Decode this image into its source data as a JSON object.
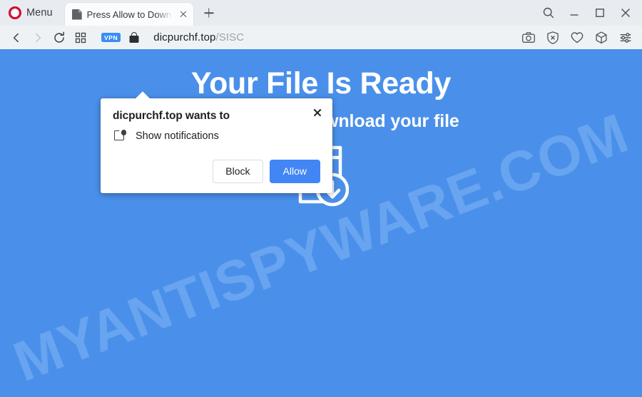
{
  "browser": {
    "name": "Opera",
    "menu_label": "Menu",
    "menu_icon": "opera-logo-icon",
    "tabs": [
      {
        "title": "Press Allow to Downl",
        "favicon": "page-document-icon",
        "close_icon": "close-icon",
        "active": true
      }
    ],
    "new_tab_icon": "plus-icon",
    "window_controls": [
      {
        "name": "search-window-button",
        "icon": "search-icon"
      },
      {
        "name": "minimize-button",
        "icon": "minimize-icon"
      },
      {
        "name": "maximize-button",
        "icon": "maximize-square-icon"
      },
      {
        "name": "close-window-button",
        "icon": "close-icon"
      }
    ],
    "nav": {
      "back_icon": "chevron-left-icon",
      "forward_icon": "chevron-right-icon",
      "reload_icon": "reload-icon",
      "tab_grid_icon": "grid-squares-icon"
    },
    "address_bar": {
      "vpn_badge": "VPN",
      "security_icon": "lock-icon",
      "url_host": "dicpurchf.top",
      "url_path": "/SISC"
    },
    "toolbar_right": [
      {
        "name": "snapshot-button",
        "icon": "camera-icon"
      },
      {
        "name": "ad-blocker-button",
        "icon": "shield-x-icon"
      },
      {
        "name": "favorites-button",
        "icon": "heart-icon"
      },
      {
        "name": "extensions-button",
        "icon": "cube-icon"
      },
      {
        "name": "easy-setup-button",
        "icon": "sliders-icon"
      }
    ]
  },
  "page": {
    "background_color": "#4a90ea",
    "watermark_text": "MYANTISPYWARE.COM",
    "watermark_color": "#6aa6f0",
    "hero_title": "Your File Is Ready",
    "hero_subtitle": "Click Allow to download your file",
    "hero_icon": "book-download-icon"
  },
  "permission_dialog": {
    "title": "dicpurchf.top wants to",
    "permission_icon": "notification-bell-icon",
    "permission_label": "Show notifications",
    "block_label": "Block",
    "allow_label": "Allow",
    "close_icon": "close-icon",
    "allow_color": "#4285f4"
  }
}
